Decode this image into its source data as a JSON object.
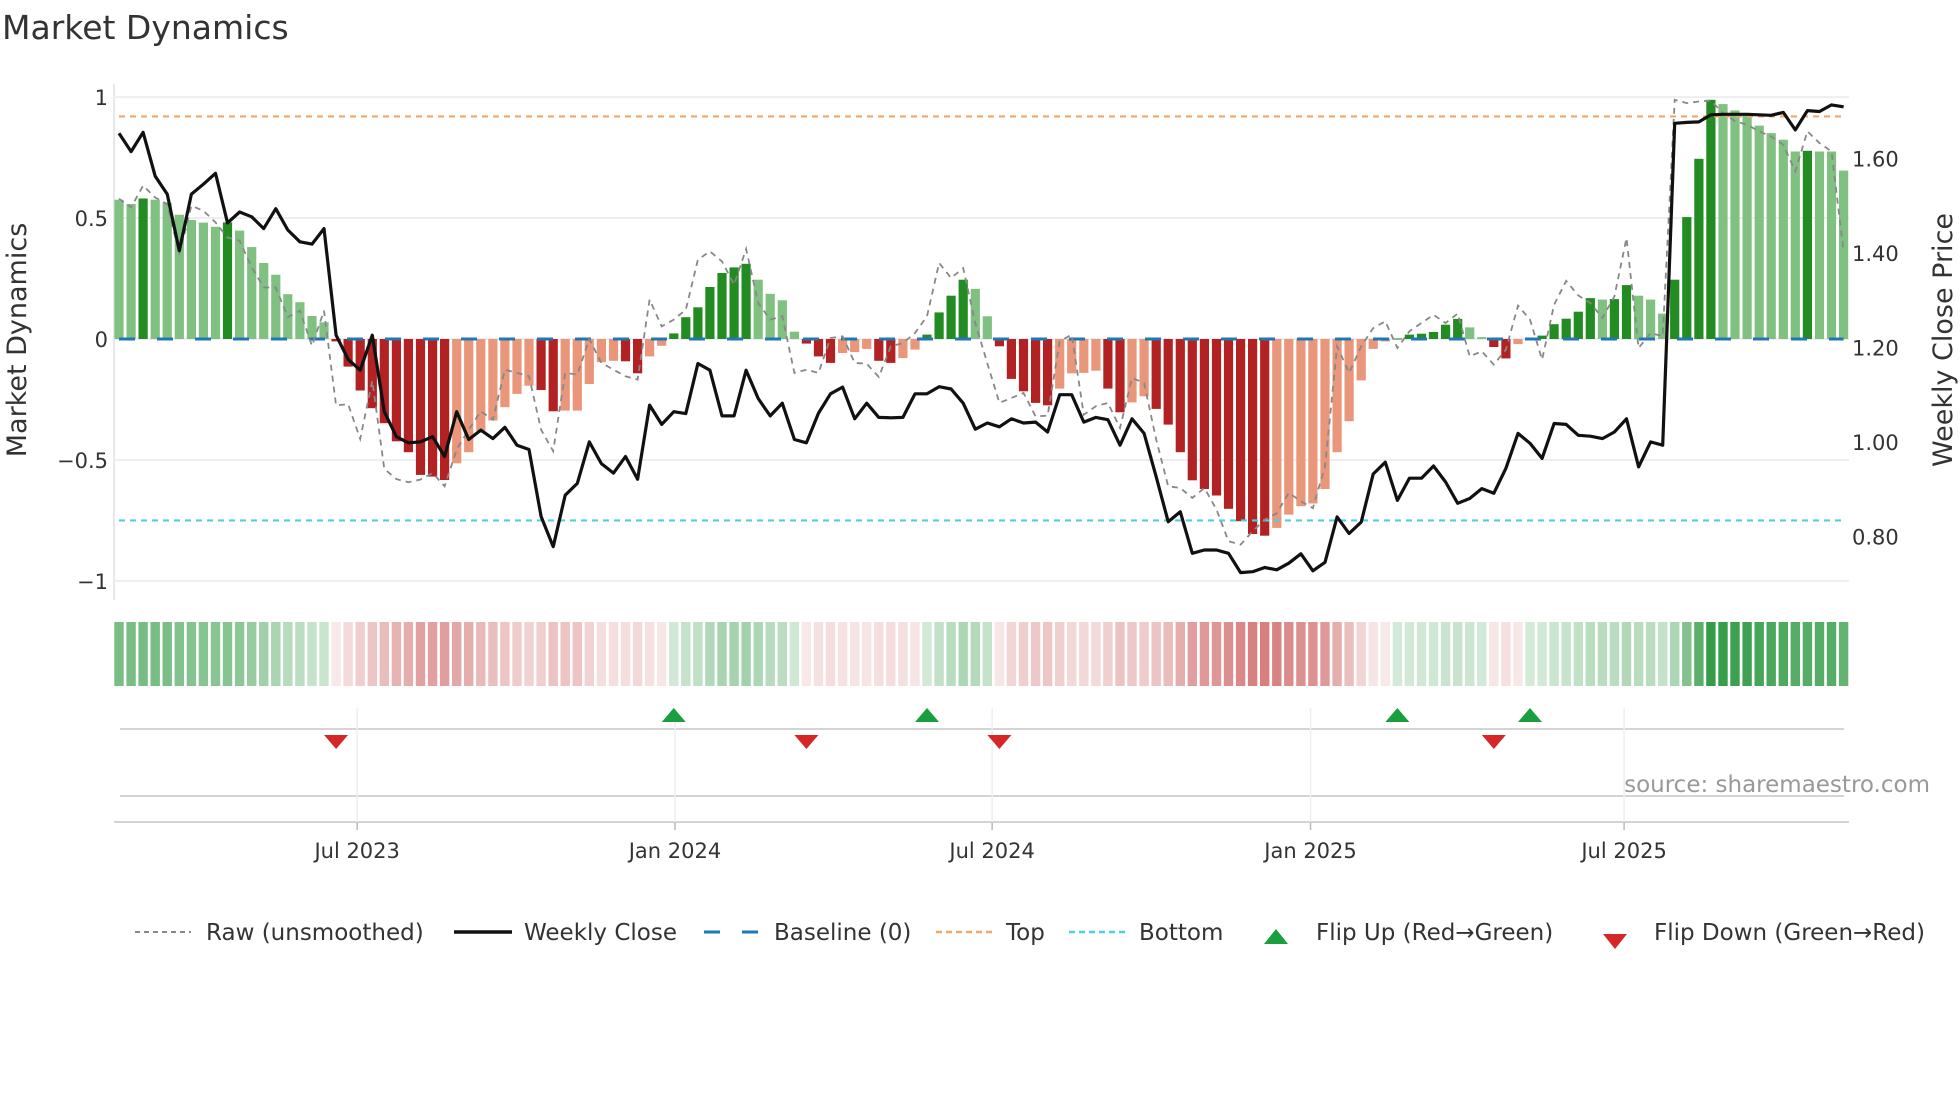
{
  "chart_data": {
    "type": "bar",
    "title": "Market Dynamics",
    "ylabel": "Market Dynamics",
    "y2label": "Weekly Close Price",
    "ylim": [
      -1.05,
      1.05
    ],
    "y2lim": [
      0.68,
      1.75
    ],
    "yticks": [
      {
        "v": 1,
        "label": "1"
      },
      {
        "v": 0.5,
        "label": "0.5"
      },
      {
        "v": 0,
        "label": "0"
      },
      {
        "v": -0.5,
        "label": "−0.5"
      },
      {
        "v": -1,
        "label": "−1"
      }
    ],
    "y2ticks": [
      {
        "v": 1.6,
        "label": "1.60"
      },
      {
        "v": 1.4,
        "label": "1.40"
      },
      {
        "v": 1.2,
        "label": "1.20"
      },
      {
        "v": 1.0,
        "label": "1.00"
      },
      {
        "v": 0.8,
        "label": "0.80"
      }
    ],
    "x_unit": "week index",
    "xticks": [
      {
        "v": 19.75,
        "label": "Jul 2023"
      },
      {
        "v": 46.1,
        "label": "Jan 2024"
      },
      {
        "v": 72.4,
        "label": "Jul 2024"
      },
      {
        "v": 98.8,
        "label": "Jan 2025"
      },
      {
        "v": 124.8,
        "label": "Jul 2025"
      }
    ],
    "top_level": 0.92,
    "bottom_level": -0.75,
    "baseline": 0,
    "smoothed": [
      0.576,
      0.558,
      0.581,
      0.576,
      0.563,
      0.514,
      0.492,
      0.481,
      0.464,
      0.482,
      0.448,
      0.38,
      0.314,
      0.266,
      0.185,
      0.152,
      0.095,
      0.069,
      -0.01,
      -0.114,
      -0.213,
      -0.286,
      -0.348,
      -0.423,
      -0.468,
      -0.562,
      -0.569,
      -0.583,
      -0.514,
      -0.468,
      -0.379,
      -0.337,
      -0.282,
      -0.227,
      -0.193,
      -0.211,
      -0.299,
      -0.296,
      -0.296,
      -0.186,
      -0.096,
      -0.09,
      -0.092,
      -0.142,
      -0.072,
      -0.028,
      0.023,
      0.09,
      0.131,
      0.215,
      0.273,
      0.296,
      0.311,
      0.245,
      0.187,
      0.16,
      0.03,
      -0.019,
      -0.072,
      -0.099,
      -0.058,
      -0.054,
      -0.041,
      -0.09,
      -0.099,
      -0.079,
      -0.044,
      0.018,
      0.11,
      0.179,
      0.245,
      0.207,
      0.094,
      -0.03,
      -0.165,
      -0.216,
      -0.264,
      -0.274,
      -0.205,
      -0.142,
      -0.14,
      -0.131,
      -0.205,
      -0.303,
      -0.262,
      -0.237,
      -0.289,
      -0.354,
      -0.468,
      -0.584,
      -0.62,
      -0.647,
      -0.702,
      -0.753,
      -0.806,
      -0.813,
      -0.781,
      -0.726,
      -0.691,
      -0.68,
      -0.62,
      -0.468,
      -0.34,
      -0.171,
      -0.041,
      -0.01,
      0.002,
      0.018,
      0.022,
      0.029,
      0.059,
      0.083,
      0.048,
      0.008,
      -0.033,
      -0.08,
      -0.021,
      0.005,
      0.014,
      0.061,
      0.084,
      0.113,
      0.169,
      0.163,
      0.165,
      0.223,
      0.179,
      0.163,
      0.105,
      0.245,
      0.504,
      0.745,
      0.989,
      0.971,
      0.945,
      0.923,
      0.882,
      0.851,
      0.824,
      0.775,
      0.778,
      0.775,
      0.775,
      0.696
    ],
    "raw": [
      0.58,
      0.544,
      0.634,
      0.585,
      0.558,
      0.35,
      0.551,
      0.53,
      0.482,
      0.42,
      0.406,
      0.296,
      0.213,
      0.213,
      0.09,
      0.117,
      -0.028,
      0.117,
      -0.275,
      -0.269,
      -0.413,
      -0.172,
      -0.537,
      -0.579,
      -0.592,
      -0.581,
      -0.554,
      -0.609,
      -0.457,
      -0.375,
      -0.299,
      -0.333,
      -0.127,
      -0.14,
      -0.154,
      -0.375,
      -0.464,
      -0.14,
      -0.147,
      0,
      -0.099,
      -0.127,
      -0.154,
      -0.168,
      0.163,
      0.052,
      0.08,
      0.121,
      0.328,
      0.362,
      0.321,
      0.225,
      0.372,
      0.149,
      0.08,
      0.094,
      -0.14,
      -0.127,
      -0.14,
      0.004,
      0.011,
      -0.099,
      -0.102,
      -0.157,
      -0.03,
      -0.017,
      0.025,
      0.094,
      0.314,
      0.252,
      0.293,
      0.066,
      -0.1,
      -0.264,
      -0.244,
      -0.223,
      -0.32,
      -0.317,
      -0.01,
      0.018,
      -0.313,
      -0.278,
      -0.264,
      -0.368,
      -0.161,
      -0.182,
      -0.416,
      -0.609,
      -0.616,
      -0.657,
      -0.616,
      -0.705,
      -0.836,
      -0.85,
      -0.795,
      -0.747,
      -0.72,
      -0.636,
      -0.671,
      -0.699,
      -0.527,
      -0.03,
      -0.14,
      -0.03,
      0.045,
      0.073,
      -0.037,
      0.032,
      0.066,
      0.1,
      0.066,
      0.105,
      -0.072,
      -0.051,
      -0.106,
      -0.044,
      0.138,
      0.08,
      -0.085,
      0.142,
      0.24,
      0.18,
      0.149,
      0.087,
      0.176,
      0.417,
      -0.037,
      0.025,
      0.011,
      0.989,
      0.975,
      0.982,
      0.986,
      0.934,
      0.9,
      0.886,
      0.858,
      0.837,
      0.803,
      0.693,
      0.858,
      0.81,
      0.775,
      0.362
    ],
    "close": [
      1.654,
      1.615,
      1.656,
      1.563,
      1.525,
      1.405,
      1.525,
      1.546,
      1.569,
      1.464,
      1.487,
      1.477,
      1.452,
      1.494,
      1.449,
      1.424,
      1.419,
      1.452,
      1.226,
      1.175,
      1.152,
      1.226,
      1.064,
      1.011,
      0.998,
      1.0,
      1.011,
      0.969,
      1.064,
      1.005,
      1.025,
      1.007,
      1.031,
      0.993,
      0.984,
      0.842,
      0.778,
      0.887,
      0.912,
      1.0,
      0.954,
      0.934,
      0.969,
      0.921,
      1.078,
      1.037,
      1.064,
      1.06,
      1.166,
      1.152,
      1.055,
      1.055,
      1.152,
      1.092,
      1.055,
      1.082,
      1.005,
      0.998,
      1.061,
      1.102,
      1.116,
      1.049,
      1.082,
      1.052,
      1.051,
      1.052,
      1.102,
      1.102,
      1.117,
      1.112,
      1.082,
      1.027,
      1.04,
      1.032,
      1.049,
      1.04,
      1.042,
      1.021,
      1.1,
      1.1,
      1.042,
      1.052,
      1.047,
      0.993,
      1.049,
      1.018,
      0.926,
      0.831,
      0.852,
      0.764,
      0.771,
      0.771,
      0.764,
      0.723,
      0.725,
      0.734,
      0.729,
      0.743,
      0.763,
      0.727,
      0.745,
      0.841,
      0.806,
      0.83,
      0.932,
      0.957,
      0.876,
      0.923,
      0.923,
      0.949,
      0.915,
      0.87,
      0.88,
      0.901,
      0.891,
      0.944,
      1.018,
      0.997,
      0.965,
      1.039,
      1.037,
      1.014,
      1.012,
      1.007,
      1.021,
      1.049,
      0.947,
      1.0,
      0.993,
      1.675,
      1.677,
      1.678,
      1.693,
      1.694,
      1.694,
      1.694,
      1.693,
      1.692,
      1.698,
      1.661,
      1.702,
      1.7,
      1.714,
      1.71
    ],
    "flip_up": [
      46,
      67,
      106,
      117
    ],
    "flip_down": [
      18,
      57,
      73,
      114
    ],
    "legend": {
      "position": "bottom",
      "raw": "Raw (unsmoothed)",
      "close": "Weekly Close",
      "baseline": "Baseline (0)",
      "top": "Top",
      "bottom": "Bottom",
      "flip_up": "Flip Up (Red→Green)",
      "flip_down": "Flip Down (Green→Red)"
    },
    "colors": {
      "pos_rising": "#228b22",
      "pos_falling": "#80c080",
      "neg_falling": "#b22222",
      "neg_rising": "#e9967a",
      "baseline": "#1f77b4",
      "top": "#f0a868",
      "bottom": "#4dd0e1",
      "raw": "#888888",
      "close": "#111111",
      "flip_up": "#1a9e3f",
      "flip_down": "#d62728"
    }
  },
  "source": "source: sharemaestro.com"
}
